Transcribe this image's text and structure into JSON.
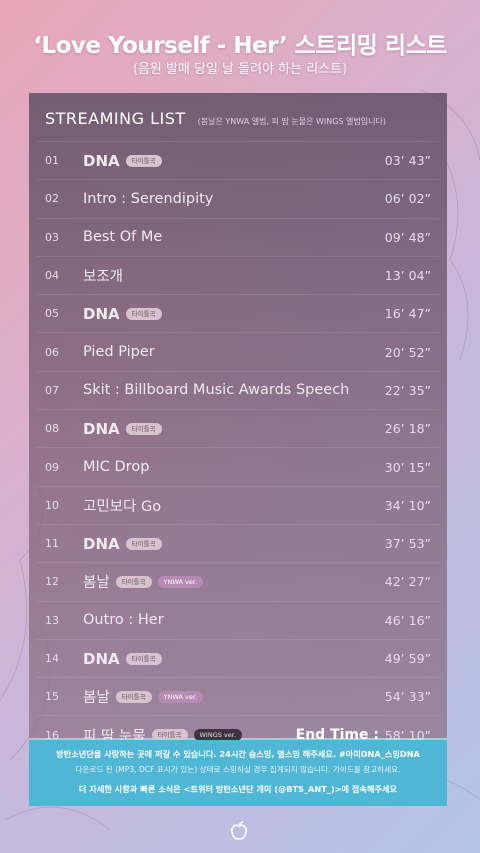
{
  "header": {
    "title": "‘Love Yourself - Her’ 스트리밍 리스트",
    "subtitle": "(음원 발매 당일 날 돌려야 하는 리스트)"
  },
  "panel": {
    "title": "STREAMING LIST",
    "note": "(봄날은 YNWA 앨범, 피 땀 눈물은 WINGS 앨범입니다)"
  },
  "badges": {
    "title_track": "타이틀곡",
    "ynwa": "YNWA ver.",
    "wings": "WINGS ver."
  },
  "tracks": [
    {
      "num": "01",
      "name": "DNA",
      "time": "03’ 43”"
    },
    {
      "num": "02",
      "name": "Intro : Serendipity",
      "time": "06’ 02”"
    },
    {
      "num": "03",
      "name": "Best Of Me",
      "time": "09’ 48”"
    },
    {
      "num": "04",
      "name": "보조개",
      "time": "13’ 04”"
    },
    {
      "num": "05",
      "name": "DNA",
      "time": "16’ 47”"
    },
    {
      "num": "06",
      "name": "Pied Piper",
      "time": "20’ 52”"
    },
    {
      "num": "07",
      "name": "Skit : Billboard Music Awards Speech",
      "time": "22’ 35”"
    },
    {
      "num": "08",
      "name": "DNA",
      "time": "26’ 18”"
    },
    {
      "num": "09",
      "name": "MIC Drop",
      "time": "30’ 15”"
    },
    {
      "num": "10",
      "name": "고민보다 Go",
      "time": "34’ 10”"
    },
    {
      "num": "11",
      "name": "DNA",
      "time": "37’ 53”"
    },
    {
      "num": "12",
      "name": "봄날",
      "time": "42’ 27”"
    },
    {
      "num": "13",
      "name": "Outro : Her",
      "time": "46’ 16”"
    },
    {
      "num": "14",
      "name": "DNA",
      "time": "49’ 59”"
    },
    {
      "num": "15",
      "name": "봄날",
      "time": "54’ 33”"
    },
    {
      "num": "16",
      "name": "피 땀 눈물",
      "time": "58’ 10”",
      "end_label": "End Time :"
    }
  ],
  "banner": {
    "line1": "방탄소년단을 사랑하는 곳에 퍼갈 수 있습니다. 24시간 숨스밍, 열스밍 해주세요. #아미DNA_스밍DNA",
    "line2": "다운로드 된 (MP3, DCF 표시가 있는) 상태로 스밍하실 경우 집계되지 않습니다. 가이드를 참고하세요.",
    "line3": "더 자세한 사항과 빠른 소식은 <트위터 방탄소년단 개미 (@BTS_ANT_)>에 접속해주세요"
  },
  "logo_icon": "apple-logo-icon"
}
